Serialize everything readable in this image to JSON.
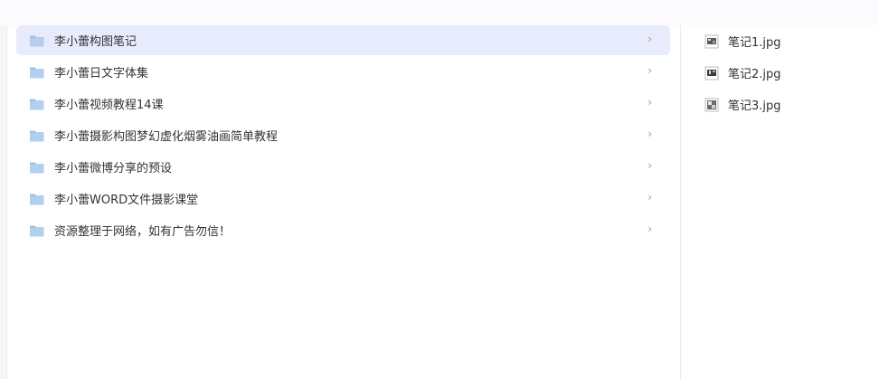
{
  "folders": [
    {
      "label": "李小蕾构图笔记",
      "chevron": "›",
      "selected": true
    },
    {
      "label": "李小蕾日文字体集",
      "chevron": "›"
    },
    {
      "label": "李小蕾视频教程14课",
      "chevron": "›"
    },
    {
      "label": "李小蕾摄影构图梦幻虚化烟雾油画简单教程",
      "chevron": "›"
    },
    {
      "label": "李小蕾微博分享的预设",
      "chevron": "›"
    },
    {
      "label": "李小蕾WORD文件摄影课堂",
      "chevron": "›"
    },
    {
      "label": "资源整理于网络，如有广告勿信！",
      "chevron": "›"
    }
  ],
  "files": [
    {
      "label": "笔记1.jpg",
      "icon": "image-file-icon"
    },
    {
      "label": "笔记2.jpg",
      "icon": "image-file-icon"
    },
    {
      "label": "笔记3.jpg",
      "icon": "image-file-icon"
    }
  ],
  "colors": {
    "folder_icon": "#9fc1e6",
    "selected_row": "#e8ebfc"
  }
}
